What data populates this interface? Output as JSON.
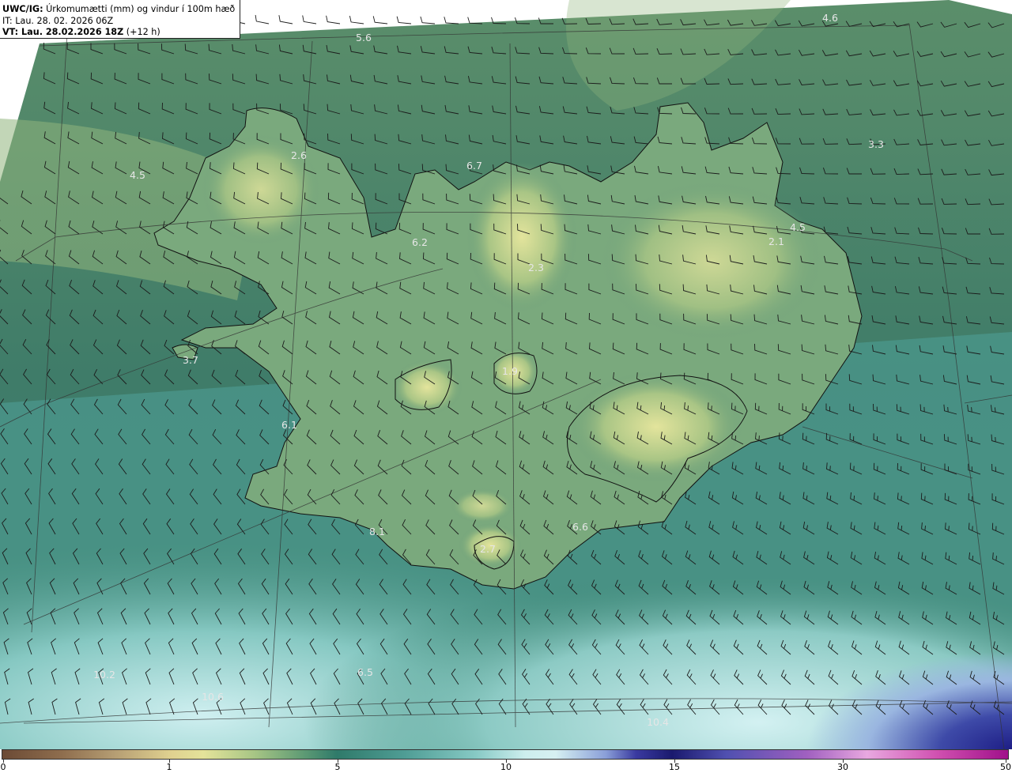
{
  "header": {
    "model_prefix": "UWC/IG:",
    "title": " Úrkomumætti (mm) og vindur í 100m hæð",
    "init_time": "IT: Lau. 28. 02. 2026 06Z",
    "valid_prefix": "VT: Lau. 28.02.2026 18Z",
    "valid_suffix": " (+12 h)"
  },
  "colorbar": {
    "ticks": [
      "0",
      "1",
      "5",
      "10",
      "15",
      "30",
      "50"
    ]
  },
  "point_values": [
    "5.6",
    "4.6",
    "3.3",
    "4.5",
    "2.6",
    "6.7",
    "6.2",
    "4.5",
    "2.1",
    "2.3",
    "3.7",
    "1.9",
    "6.1",
    "6.6",
    "8.1",
    "2.7",
    "10.2",
    "6.5",
    "10.6",
    "10.4"
  ],
  "colors": {
    "land_high": "#e2e39a",
    "land_mid": "#6fa27a",
    "sea_low": "#3d7f6d",
    "sea_high": "#c7ecec",
    "deep_precip": "#2e2e92",
    "coastline": "#111111",
    "barb": "#1b1b1b",
    "label": "#e6e6e6"
  }
}
